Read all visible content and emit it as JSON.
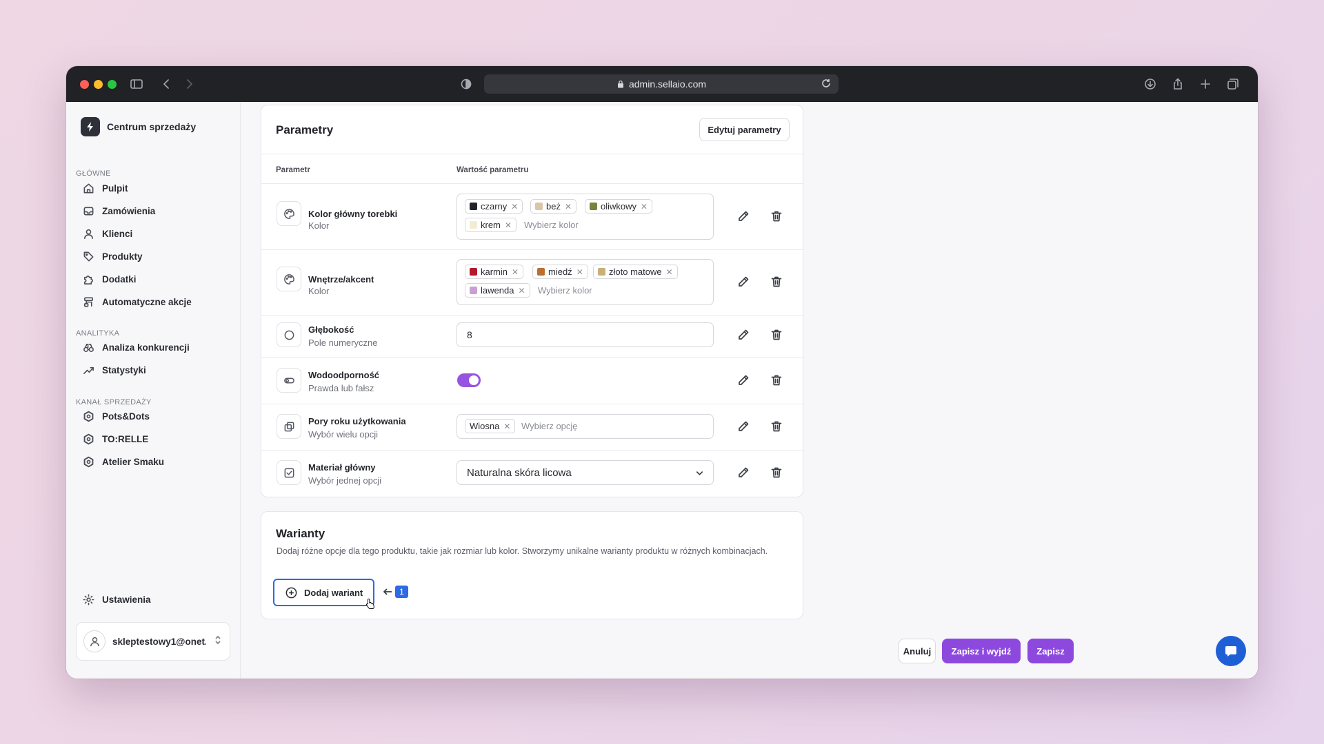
{
  "browser": {
    "url": "admin.sellaio.com"
  },
  "sidebar": {
    "brand": "Centrum sprzedaży",
    "sections": {
      "main": "GŁÓWNE",
      "analytics": "ANALITYKA",
      "channels": "KANAŁ SPRZEDAŻY"
    },
    "main_items": [
      "Pulpit",
      "Zamówienia",
      "Klienci",
      "Produkty",
      "Dodatki",
      "Automatyczne akcje"
    ],
    "analytics_items": [
      "Analiza konkurencji",
      "Statystyki"
    ],
    "channel_items": [
      "Pots&Dots",
      "TO:RELLE",
      "Atelier Smaku"
    ],
    "settings": "Ustawienia",
    "account": "skleptestowy1@onet..."
  },
  "params": {
    "title": "Parametry",
    "edit_button": "Edytuj parametry",
    "col_param": "Parametr",
    "col_value": "Wartość parametru",
    "rows": [
      {
        "name": "Kolor główny torebki",
        "type": "Kolor",
        "chips": [
          {
            "label": "czarny",
            "color": "#222429"
          },
          {
            "label": "beż",
            "color": "#d8c6a8"
          },
          {
            "label": "oliwkowy",
            "color": "#76843c"
          },
          {
            "label": "krem",
            "color": "#f3ecd4"
          }
        ],
        "placeholder": "Wybierz kolor"
      },
      {
        "name": "Wnętrze/akcent",
        "type": "Kolor",
        "chips": [
          {
            "label": "karmin",
            "color": "#b3182b"
          },
          {
            "label": "miedź",
            "color": "#b86f30"
          },
          {
            "label": "złoto matowe",
            "color": "#c8b078"
          },
          {
            "label": "lawenda",
            "color": "#c9a0d4"
          }
        ],
        "placeholder": "Wybierz kolor"
      },
      {
        "name": "Głębokość",
        "type": "Pole numeryczne",
        "value": "8"
      },
      {
        "name": "Wodoodporność",
        "type": "Prawda lub fałsz",
        "toggle_on": true
      },
      {
        "name": "Pory roku użytkowania",
        "type": "Wybór wielu opcji",
        "chips": [
          {
            "label": "Wiosna"
          }
        ],
        "placeholder": "Wybierz opcję"
      },
      {
        "name": "Materiał główny",
        "type": "Wybór jednej opcji",
        "value": "Naturalna skóra licowa"
      }
    ]
  },
  "variants": {
    "title": "Warianty",
    "description": "Dodaj różne opcje dla tego produktu, takie jak rozmiar lub kolor. Stworzymy unikalne warianty produktu w różnych kombinacjach.",
    "add_button": "Dodaj wariant",
    "annotation": "1"
  },
  "footer": {
    "cancel": "Anuluj",
    "save_exit": "Zapisz i wyjdź",
    "save": "Zapisz"
  },
  "colors": {
    "accent": "#8d49de",
    "toggle": "#9654e0",
    "focus": "#2d6ae3"
  }
}
